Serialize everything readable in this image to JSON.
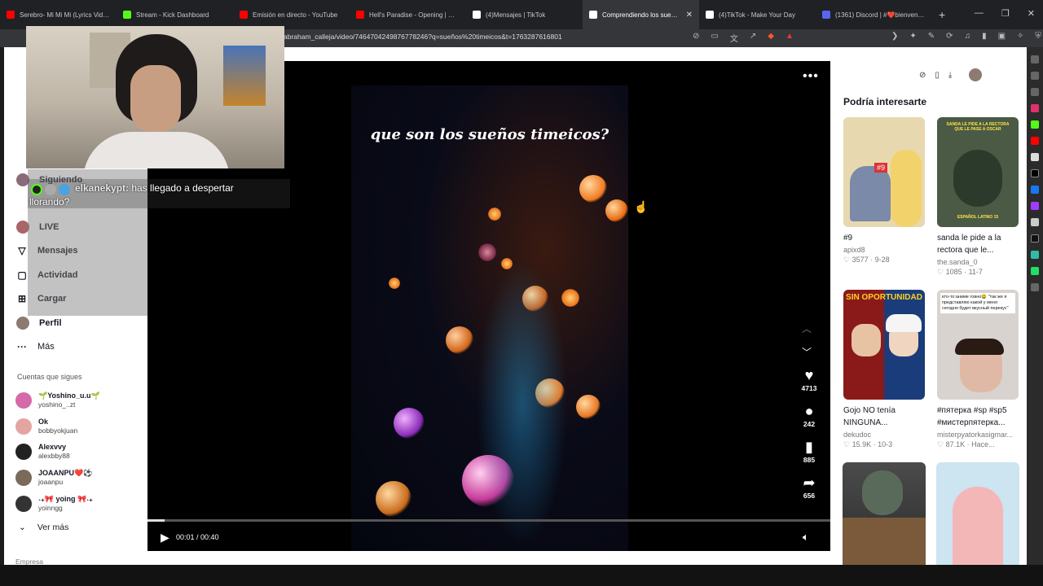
{
  "tabs": [
    {
      "title": "Serebro- Mi Mi Mi (Lyrics Video)",
      "color": "#ff0000"
    },
    {
      "title": "Stream - Kick Dashboard",
      "color": "#53fc18"
    },
    {
      "title": "Emisión en directo - YouTube",
      "color": "#ff0000"
    },
    {
      "title": "Hell's Paradise - Opening | Wor",
      "color": "#ff0000"
    },
    {
      "title": "(4)Mensajes | TikTok",
      "color": "#ffffff"
    },
    {
      "title": "Comprendiendo los sueños",
      "color": "#ffffff",
      "active": true
    },
    {
      "title": "(4)TikTok - Make Your Day",
      "color": "#ffffff"
    },
    {
      "title": "(1361) Discord | #❤️bienvenida",
      "color": "#5865f2"
    }
  ],
  "url": "abraham_calleja/video/7464704249876778246?q=sueños%20timeicos&t=1763287616801",
  "nav": [
    {
      "label": "Siguiendo",
      "icon": "following-icon"
    },
    {
      "label": "LIVE",
      "icon": "live-icon"
    },
    {
      "label": "Mensajes",
      "icon": "messages-icon"
    },
    {
      "label": "Actividad",
      "icon": "activity-icon"
    },
    {
      "label": "Cargar",
      "icon": "upload-icon"
    },
    {
      "label": "Perfil",
      "icon": "profile-icon"
    },
    {
      "label": "Más",
      "icon": "more-icon"
    }
  ],
  "following_title": "Cuentas que sigues",
  "following": [
    {
      "name": "🌱Yoshino_u.u🌱",
      "user": "yoshino_..zt"
    },
    {
      "name": "Ok",
      "user": "bobbyokjuan"
    },
    {
      "name": "Alexvvy",
      "user": "alexbby88"
    },
    {
      "name": "JOAANPU❤️⚽",
      "user": "joaanpu"
    },
    {
      "name": "˖₊🎀 yoing 🎀˖₊",
      "user": "yoinngg"
    }
  ],
  "see_more": "Ver más",
  "company": "Empresa",
  "chat": {
    "user": "elkanekypt:",
    "message": "has llegado a despertar",
    "message2": "llorando?"
  },
  "video": {
    "caption": "que son los sueños timeicos?",
    "time": "00:01 / 00:40",
    "likes": "4713",
    "comments": "242",
    "saves": "885",
    "shares": "656",
    "progress": 0.025
  },
  "suggest_title": "Podría interesarte",
  "cards": [
    {
      "title": "#9",
      "user": "apixd8",
      "stats": "♡ 3577 · 9-28"
    },
    {
      "title": "sanda le pide a la rectora que le...",
      "user": "the.sanda_0",
      "stats": "♡ 1085 · 11-7"
    },
    {
      "title": "Gojo NO tenía NINGUNA...",
      "user": "dekudoc",
      "stats": "♡ 15.9K · 10-3"
    },
    {
      "title": "#пятерка #sp #sp5 #мистерпятерка...",
      "user": "misterpyatorkasigmar...",
      "stats": "♡ 87.1K · Hace..."
    }
  ],
  "thumb_texts": {
    "t1": "#9",
    "t2": "SANDA LE PIDE A LA RECTORA QUE LE PASE A OSCAR",
    "t2b": "ESPAÑOL LATINO 15",
    "t3": "SIN OPORTUNIDAD",
    "t4": "кто-то:аниме говно🤮 \"так же я представляю какой у меня сегодня будет вкусный перекус\""
  }
}
